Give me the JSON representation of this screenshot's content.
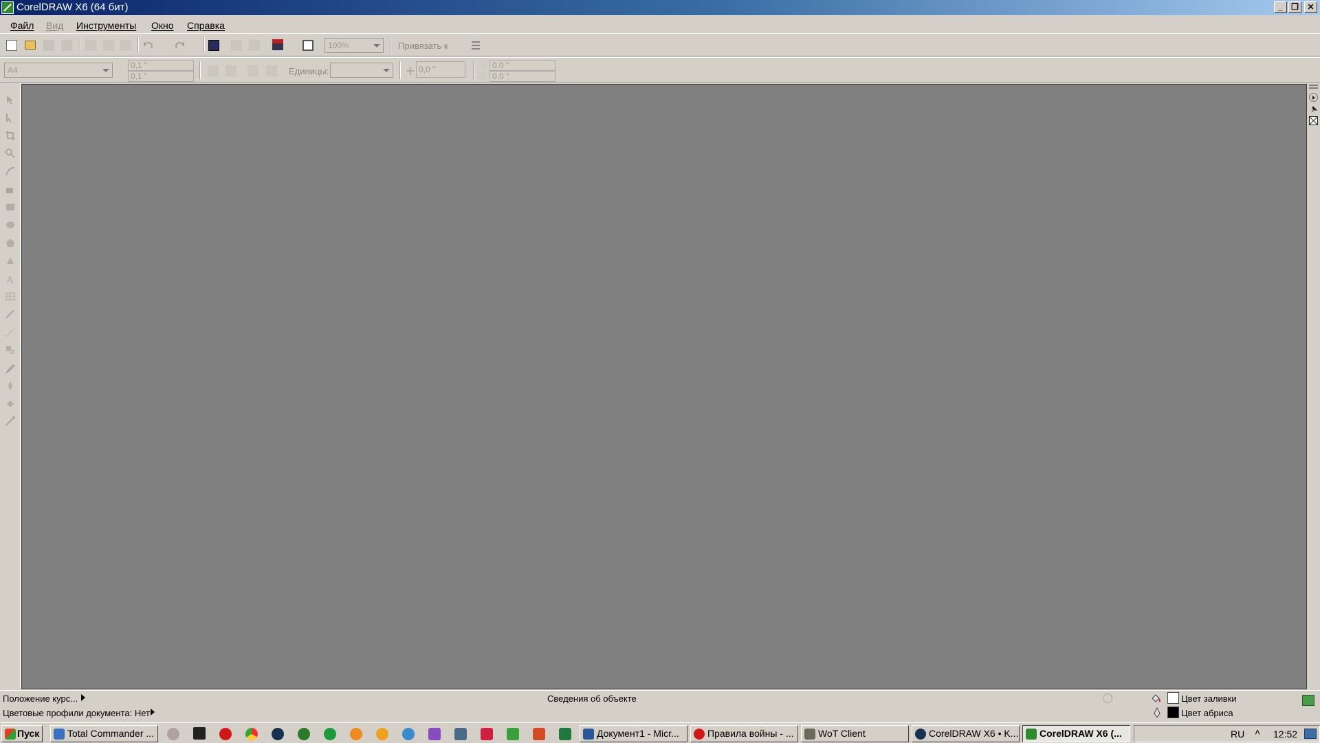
{
  "window": {
    "title": "CorelDRAW X6 (64 бит)",
    "minimize": "_",
    "restore": "❐",
    "close": "✕"
  },
  "menu": [
    "Файл",
    "Вид",
    "Инструменты",
    "Окно",
    "Справка"
  ],
  "standard_toolbar": {
    "zoom_value": "100%",
    "snap_label": "Привязать к"
  },
  "property_bar": {
    "page_size": "A4",
    "nudge_x": "0,1 \"",
    "nudge_y": "0,1 \"",
    "units_label": "Единицы:",
    "units_value": "",
    "rotation": "0,0 \"",
    "dup_x": "0,0 \"",
    "dup_y": "0,0 \""
  },
  "status": {
    "cursor_position": "Положение курс...",
    "color_profiles": "Цветовые профили документа: Нет",
    "object_info": "Сведения об объекте",
    "fill_label": "Цвет заливки",
    "outline_label": "Цвет абриса"
  },
  "taskbar": {
    "start": "Пуск",
    "buttons": [
      "Total Commander ...",
      "Документ1 - Micr...",
      "Правила войны - ...",
      "WoT Client",
      "CorelDRAW X6 • K...",
      "CorelDRAW X6 (..."
    ],
    "language": "RU",
    "clock": "12:52"
  },
  "colors": {
    "title_gradient_start": "#0a246a",
    "canvas": "#808080",
    "chrome": "#d4d0c8"
  }
}
